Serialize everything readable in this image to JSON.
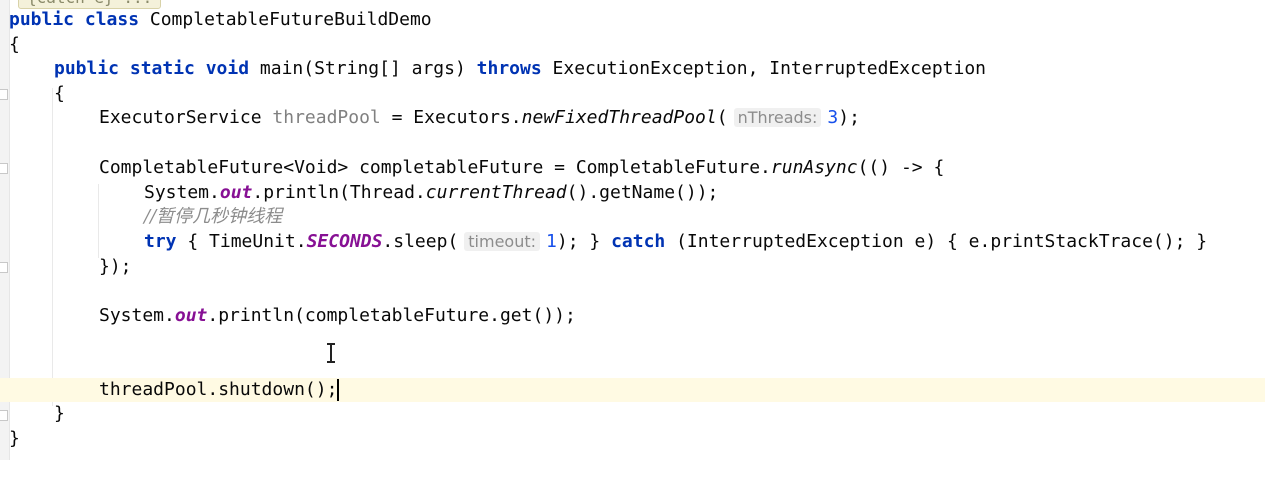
{
  "editor": {
    "clipped_line": "{catch e} ...",
    "lines": {
      "class_kw": "public class",
      "class_name": " CompletableFutureBuildDemo",
      "open_brace_1": "{",
      "main_kw1": "public static void",
      "main_sig": " main(String[] args) ",
      "main_throws": "throws",
      "main_exc": " ExecutionException, InterruptedException",
      "open_brace_2": "{",
      "pool_type": "ExecutorService ",
      "pool_var": "threadPool",
      "pool_assign": " = Executors.",
      "pool_method": "newFixedThreadPool",
      "pool_paren": "(",
      "pool_hint": "nThreads:",
      "pool_arg": "3",
      "pool_end": ");",
      "cf_decl": "CompletableFuture<Void> completableFuture = CompletableFuture.",
      "cf_method": "runAsync",
      "cf_end": "(() -> {",
      "print_prefix": "System.",
      "print_out": "out",
      "print_mid": ".println(Thread.",
      "print_current": "currentThread",
      "print_end": "().getName());",
      "comment": "//暂停几秒钟线程",
      "try_kw": "try",
      "try_mid": " { TimeUnit.",
      "try_seconds": "SECONDS",
      "try_sleep": ".sleep(",
      "try_hint": "timeout:",
      "try_arg": "1",
      "try_close": "); } ",
      "catch_kw": "catch",
      "catch_rest": " (InterruptedException e) { e.printStackTrace(); }",
      "close_lambda": "});",
      "get_prefix": "System.",
      "get_out": "out",
      "get_end": ".println(completableFuture.get());",
      "shutdown": "threadPool.shutdown();",
      "close_brace_2": "}",
      "close_brace_1": "}"
    }
  }
}
